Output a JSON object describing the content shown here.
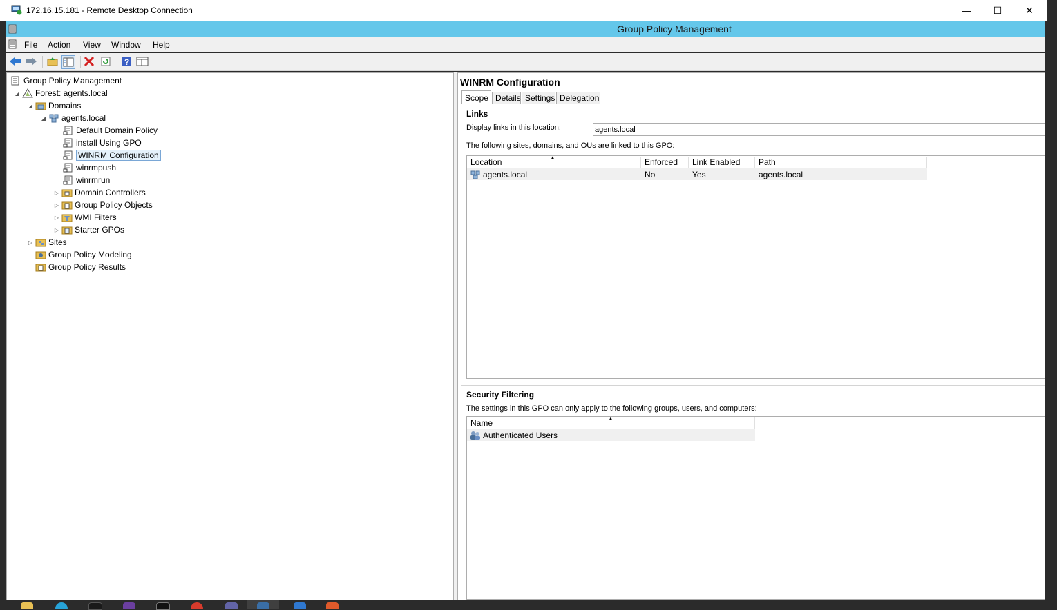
{
  "rdp": {
    "title": "172.16.15.181 - Remote Desktop Connection",
    "minimize": "—",
    "maximize": "☐",
    "close": "✕"
  },
  "app": {
    "title": "Group Policy Management"
  },
  "menu": [
    "File",
    "Action",
    "View",
    "Window",
    "Help"
  ],
  "toolbar": [
    "back-icon",
    "forward-icon",
    "up-folder-icon",
    "show-hide-tree-icon",
    "delete-icon",
    "refresh-icon",
    "help-icon",
    "properties-icon"
  ],
  "tree": {
    "root": "Group Policy Management",
    "forest": "Forest: agents.local",
    "domains": "Domains",
    "domain": "agents.local",
    "gpos": [
      "Default Domain Policy",
      "install Using GPO",
      "WINRM Configuration",
      "winrmpush",
      "winrmrun"
    ],
    "containers": [
      "Domain Controllers",
      "Group Policy Objects",
      "WMI Filters",
      "Starter GPOs"
    ],
    "sites": "Sites",
    "modeling": "Group Policy Modeling",
    "results": "Group Policy Results",
    "selected": "WINRM Configuration"
  },
  "detail": {
    "title": "WINRM Configuration",
    "tabs": [
      "Scope",
      "Details",
      "Settings",
      "Delegation"
    ],
    "active_tab": "Scope",
    "links_heading": "Links",
    "display_links_label": "Display links in this location:",
    "display_links_value": "agents.local",
    "linked_desc": "The following sites, domains, and OUs are linked to this GPO:",
    "links_columns": [
      "Location",
      "Enforced",
      "Link Enabled",
      "Path"
    ],
    "links_rows": [
      {
        "location": "agents.local",
        "enforced": "No",
        "link_enabled": "Yes",
        "path": "agents.local"
      }
    ],
    "security_heading": "Security Filtering",
    "security_desc": "The settings in this GPO can only apply to the following groups, users, and computers:",
    "security_columns": [
      "Name"
    ],
    "security_rows": [
      "Authenticated Users"
    ]
  },
  "colors": {
    "titlebar": "#64c7ea",
    "selection_border": "#7aa7d6",
    "selection_fill": "#e5f1fb"
  }
}
